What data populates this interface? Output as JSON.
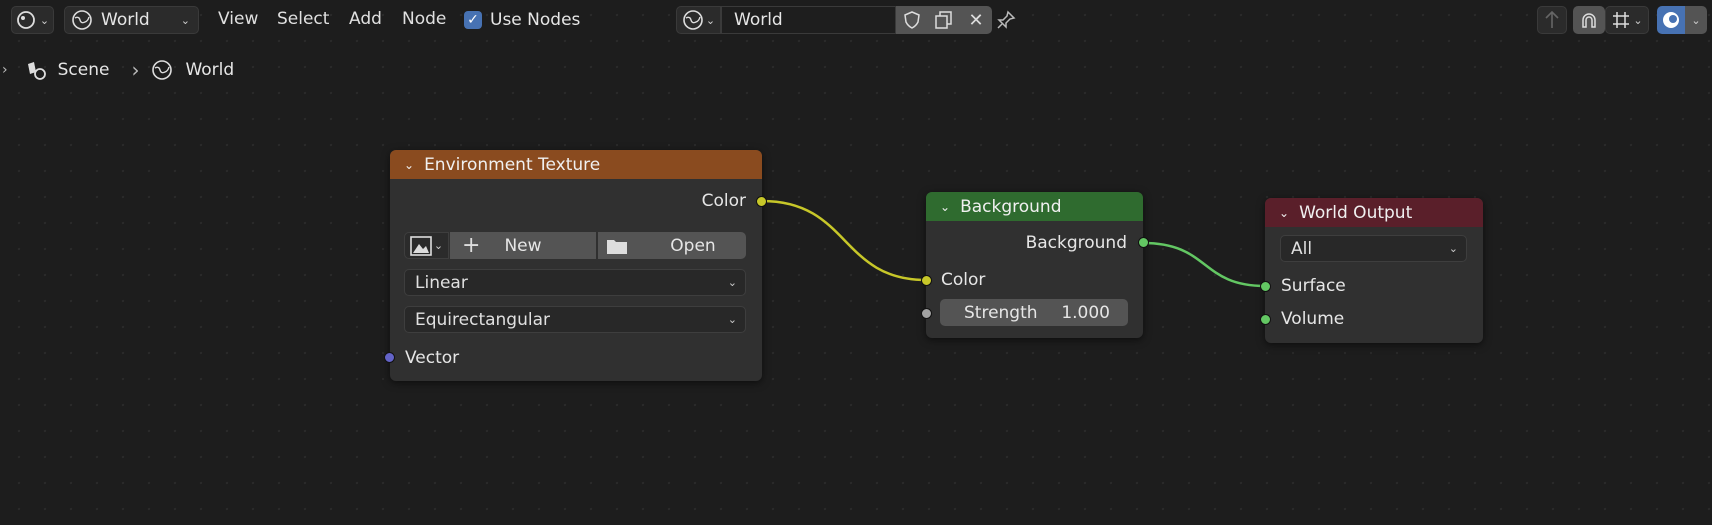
{
  "header": {
    "editor_type_icon": "node-editor-icon",
    "world_dropdown_label": "World",
    "menus": [
      "View",
      "Select",
      "Add",
      "Node"
    ],
    "use_nodes_label": "Use Nodes",
    "use_nodes_checked": true,
    "datablock_name": "World"
  },
  "breadcrumb": {
    "scene": "Scene",
    "world": "World"
  },
  "nodes": {
    "env_texture": {
      "title": "Environment Texture",
      "color_output": "Color",
      "new_label": "New",
      "open_label": "Open",
      "interpolation": "Linear",
      "projection": "Equirectangular",
      "vector_input": "Vector",
      "header_color": "#8a4b1f"
    },
    "background": {
      "title": "Background",
      "output": "Background",
      "color_input": "Color",
      "strength_label": "Strength",
      "strength_value": "1.000",
      "header_color": "#2f6b2f"
    },
    "world_output": {
      "title": "World Output",
      "target": "All",
      "surface_input": "Surface",
      "volume_input": "Volume",
      "header_color": "#5a1f2a"
    }
  },
  "colors": {
    "accent": "#4772b3",
    "link_color": "#c7c729",
    "link_shader": "#63c763"
  }
}
